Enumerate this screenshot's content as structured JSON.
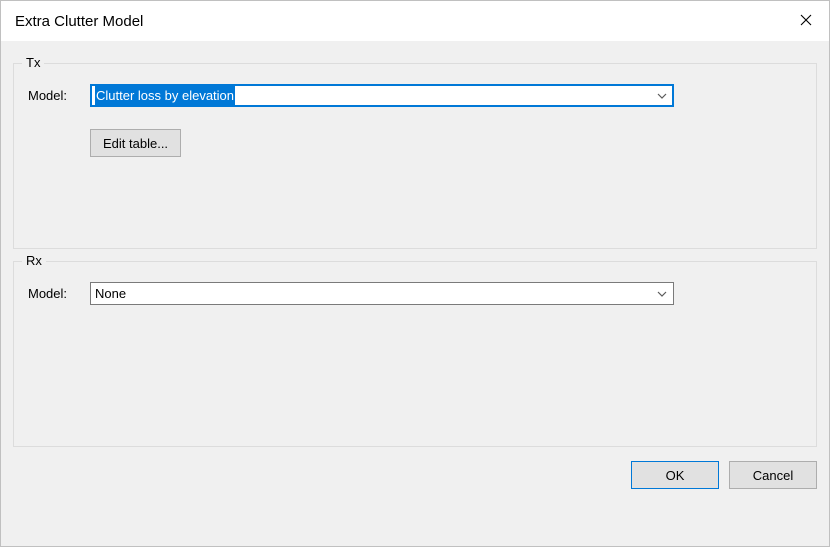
{
  "window": {
    "title": "Extra Clutter Model"
  },
  "tx": {
    "legend": "Tx",
    "model_label": "Model:",
    "model_value": "Clutter loss by elevation",
    "edit_label": "Edit table..."
  },
  "rx": {
    "legend": "Rx",
    "model_label": "Model:",
    "model_value": "None"
  },
  "buttons": {
    "ok": "OK",
    "cancel": "Cancel"
  }
}
